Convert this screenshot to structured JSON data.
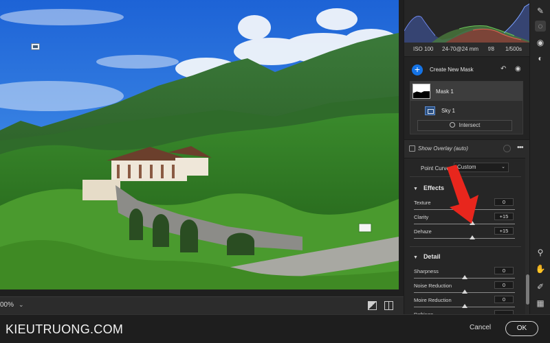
{
  "photo": {
    "alt_marker": "mask-pin"
  },
  "canvas_bar": {
    "zoom": "00%",
    "zoom_caret": "⌄"
  },
  "footer": {
    "brand": "KIEUTRUONG.COM",
    "cancel_label": "Cancel",
    "ok_label": "OK"
  },
  "exif": {
    "iso": "ISO 100",
    "lens": "24-70@24 mm",
    "aperture": "f/8",
    "shutter": "1/500s"
  },
  "masking": {
    "create_label": "Create New Mask",
    "masks": [
      {
        "label": "Mask 1"
      },
      {
        "label": "Sky 1"
      }
    ],
    "intersect_label": "Intersect",
    "show_overlay_label": "Show Overlay (auto)",
    "more_label": "•••"
  },
  "point_curve": {
    "label": "Point Curve",
    "value": "Custom",
    "caret": "⌄"
  },
  "effects": {
    "title": "Effects",
    "sliders": [
      {
        "label": "Texture",
        "value": "0",
        "position": 0.5
      },
      {
        "label": "Clarity",
        "value": "+15",
        "position": 0.575
      },
      {
        "label": "Dehaze",
        "value": "+15",
        "position": 0.575
      }
    ]
  },
  "detail": {
    "title": "Detail",
    "sliders": [
      {
        "label": "Sharpness",
        "value": "0",
        "position": 0.5
      },
      {
        "label": "Noise Reduction",
        "value": "0",
        "position": 0.5
      },
      {
        "label": "Moire Reduction",
        "value": "0",
        "position": 0.5
      },
      {
        "label": "Defringe",
        "value": "",
        "position": 0.5
      }
    ]
  },
  "colors": {
    "accent": "#1473e6",
    "annotation_arrow": "#e8261d",
    "panel_bg": "#2b2b2b"
  },
  "tools": [
    "brush-icon",
    "mask-circle-icon",
    "eye-redeye-icon",
    "presets-icon",
    "zoom-icon",
    "hand-icon",
    "eyedropper-icon",
    "grid-icon"
  ]
}
